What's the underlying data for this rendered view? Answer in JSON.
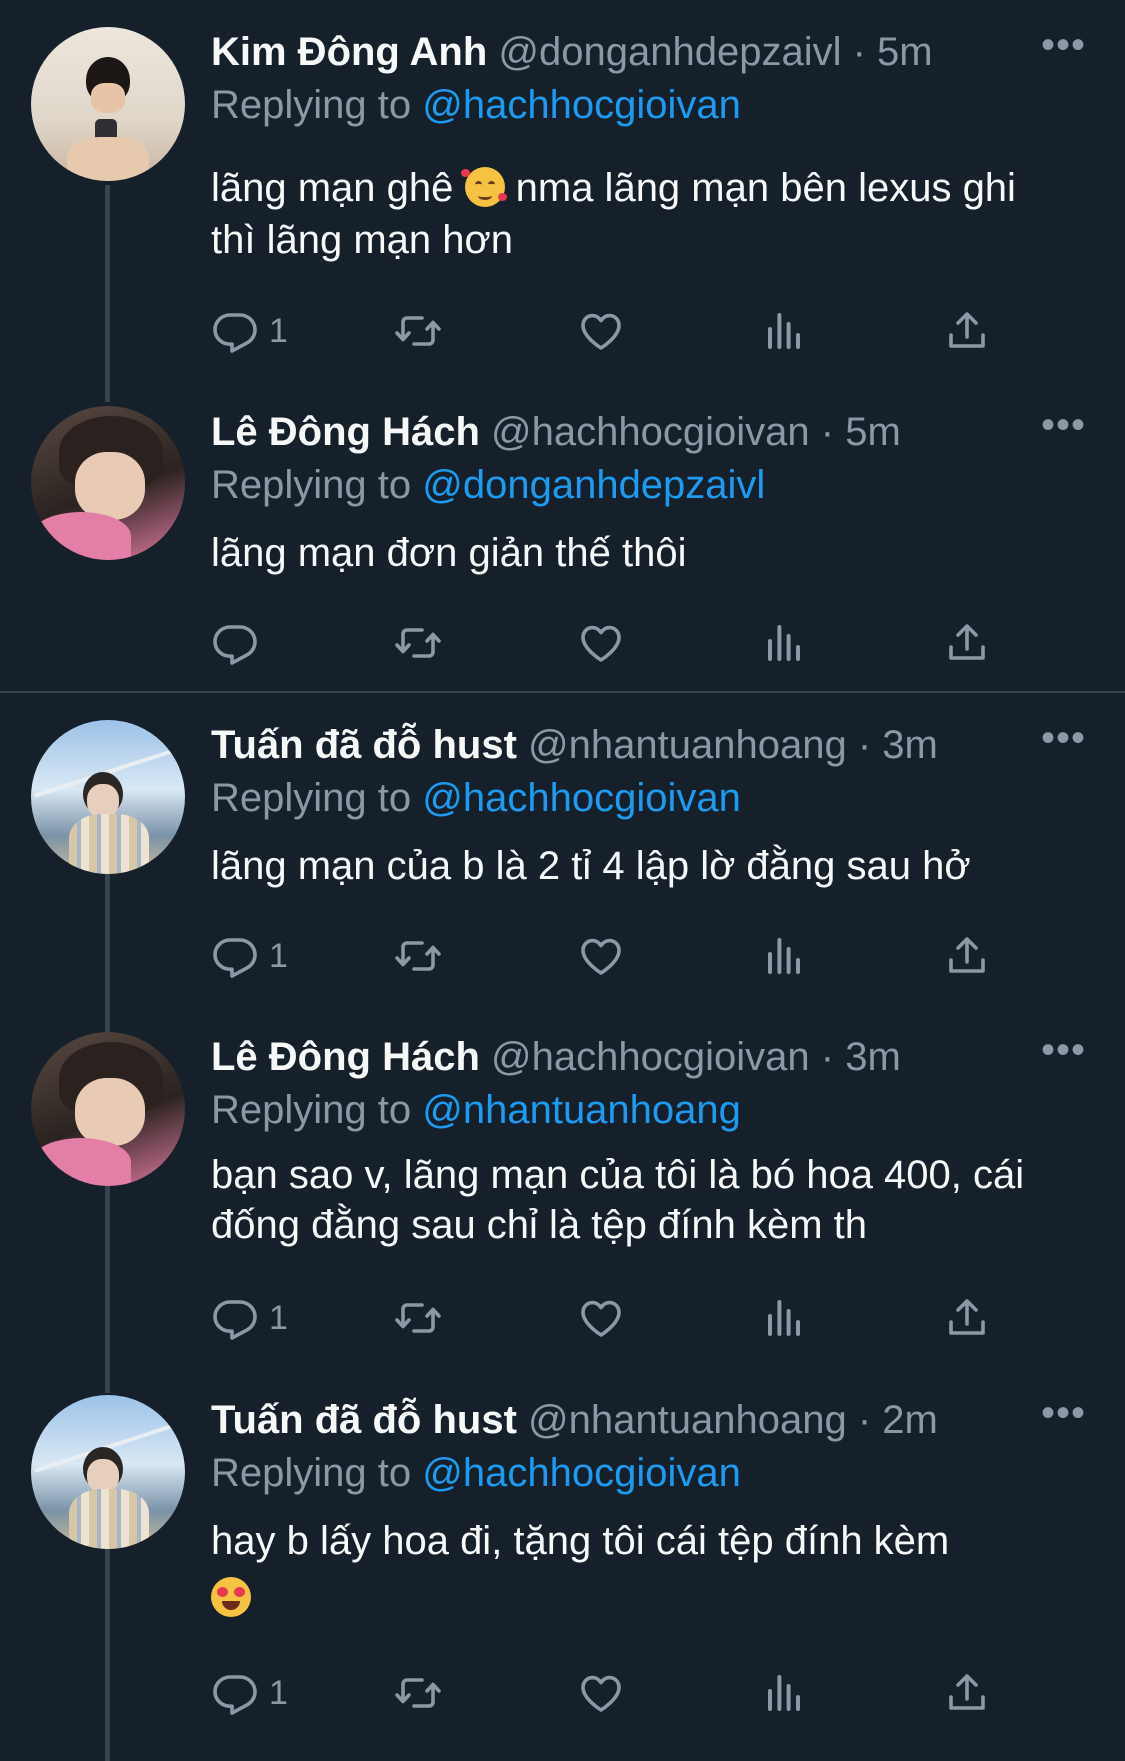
{
  "colors": {
    "background": "#15202b",
    "text_primary": "#f7f9f9",
    "text_secondary": "#8b98a5",
    "link": "#1d9bf0",
    "thread_line": "#38444d"
  },
  "icons": {
    "reply": "reply-icon",
    "retweet": "retweet-icon",
    "like": "heart-icon",
    "views": "analytics-icon",
    "share": "share-icon",
    "more": "more-icon"
  },
  "tweets": [
    {
      "name": "Kim Đông Anh",
      "handle": "@donganhdepzaivl",
      "dot": "·",
      "time": "5m",
      "reply_prefix": "Replying to ",
      "reply_to": "@hachhocgioivan",
      "text_before_emoji": "lãng mạn ghê ",
      "emoji": "smiling-face-with-hearts",
      "text_after_emoji": " nma lãng mạn bên lexus ghi thì lãng mạn hơn",
      "reply_count": "1"
    },
    {
      "name": "Lê Đông Hách",
      "handle": "@hachhocgioivan",
      "dot": "·",
      "time": "5m",
      "reply_prefix": "Replying to ",
      "reply_to": "@donganhdepzaivl",
      "text": "lãng mạn đơn giản thế thôi",
      "reply_count": ""
    },
    {
      "name": "Tuấn đã đỗ hust",
      "handle": "@nhantuanhoang",
      "dot": "·",
      "time": "3m",
      "reply_prefix": "Replying to ",
      "reply_to": "@hachhocgioivan",
      "text": "lãng mạn của b là 2 tỉ 4 lập lờ đằng sau hở",
      "reply_count": "1"
    },
    {
      "name": "Lê Đông Hách",
      "handle": "@hachhocgioivan",
      "dot": "·",
      "time": "3m",
      "reply_prefix": "Replying to ",
      "reply_to": "@nhantuanhoang",
      "text": "bạn sao v, lãng mạn của tôi là bó hoa 400, cái đống đằng sau chỉ là tệp đính kèm th",
      "reply_count": "1"
    },
    {
      "name": "Tuấn đã đỗ hust",
      "handle": "@nhantuanhoang",
      "dot": "·",
      "time": "2m",
      "reply_prefix": "Replying to ",
      "reply_to": "@hachhocgioivan",
      "text": "hay b lấy hoa đi, tặng tôi cái tệp đính kèm",
      "emoji": "smiling-face-with-heart-eyes",
      "reply_count": "1"
    }
  ]
}
